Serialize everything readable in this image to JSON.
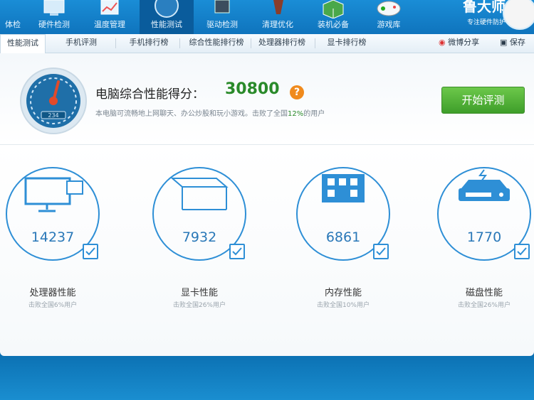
{
  "nav": {
    "items": [
      {
        "label": "体检",
        "icon": "checkup-icon"
      },
      {
        "label": "硬件检测",
        "icon": "hardware-icon"
      },
      {
        "label": "温度管理",
        "icon": "temperature-icon"
      },
      {
        "label": "性能测试",
        "icon": "speedometer-icon"
      },
      {
        "label": "驱动检测",
        "icon": "driver-icon"
      },
      {
        "label": "清理优化",
        "icon": "broom-icon"
      },
      {
        "label": "装机必备",
        "icon": "box-icon"
      },
      {
        "label": "游戏库",
        "icon": "gamepad-icon"
      }
    ],
    "active": 3,
    "brand": "鲁大师",
    "brand_tagline": "专注硬件防护"
  },
  "tabs": {
    "items": [
      "性能测试",
      "手机评测",
      "手机排行榜",
      "综合性能排行榜",
      "处理器排行榜",
      "显卡排行榜"
    ],
    "share": "微博分享",
    "save": "保存"
  },
  "summary": {
    "gauge_label": "234",
    "title": "电脑综合性能得分：",
    "score": "30800",
    "help": "?",
    "desc_pre": "本电脑可流畅地上网聊天、办公炒股和玩小游戏。击败了全国",
    "desc_pct": "12%",
    "desc_post": "的用户",
    "start_button": "开始评测"
  },
  "components": [
    {
      "name": "处理器性能",
      "score": "14237",
      "beat": "击败全国6%用户",
      "icon": "cpu-icon"
    },
    {
      "name": "显卡性能",
      "score": "7932",
      "beat": "击败全国26%用户",
      "icon": "gpu-icon"
    },
    {
      "name": "内存性能",
      "score": "6861",
      "beat": "击败全国10%用户",
      "icon": "memory-icon"
    },
    {
      "name": "磁盘性能",
      "score": "1770",
      "beat": "击败全国26%用户",
      "icon": "disk-icon"
    }
  ],
  "colors": {
    "accent": "#2e8fd6",
    "score_green": "#2a8a2a",
    "start_green": "#4fae34",
    "help_orange": "#f08a1c"
  }
}
